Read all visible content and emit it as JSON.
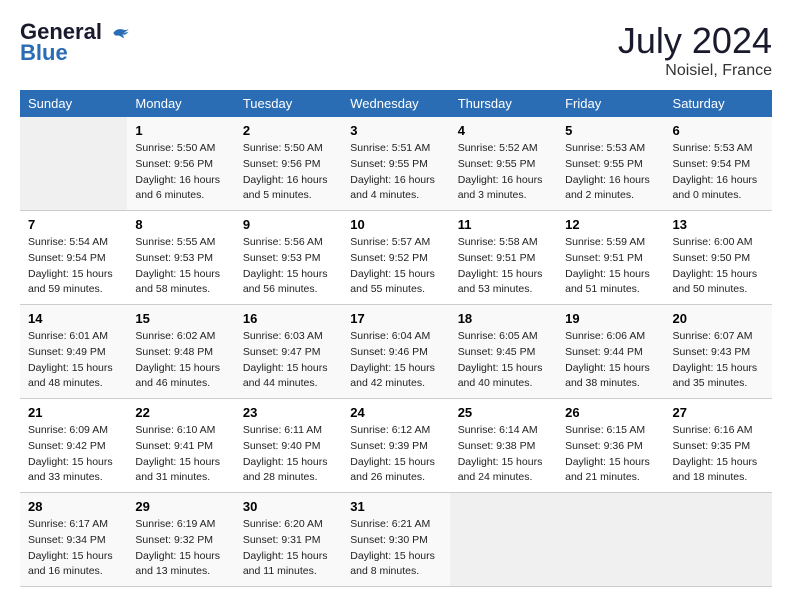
{
  "header": {
    "logo_line1": "General",
    "logo_line2": "Blue",
    "month": "July 2024",
    "location": "Noisiel, France"
  },
  "weekdays": [
    "Sunday",
    "Monday",
    "Tuesday",
    "Wednesday",
    "Thursday",
    "Friday",
    "Saturday"
  ],
  "weeks": [
    [
      {
        "day": "",
        "info": ""
      },
      {
        "day": "1",
        "info": "Sunrise: 5:50 AM\nSunset: 9:56 PM\nDaylight: 16 hours\nand 6 minutes."
      },
      {
        "day": "2",
        "info": "Sunrise: 5:50 AM\nSunset: 9:56 PM\nDaylight: 16 hours\nand 5 minutes."
      },
      {
        "day": "3",
        "info": "Sunrise: 5:51 AM\nSunset: 9:55 PM\nDaylight: 16 hours\nand 4 minutes."
      },
      {
        "day": "4",
        "info": "Sunrise: 5:52 AM\nSunset: 9:55 PM\nDaylight: 16 hours\nand 3 minutes."
      },
      {
        "day": "5",
        "info": "Sunrise: 5:53 AM\nSunset: 9:55 PM\nDaylight: 16 hours\nand 2 minutes."
      },
      {
        "day": "6",
        "info": "Sunrise: 5:53 AM\nSunset: 9:54 PM\nDaylight: 16 hours\nand 0 minutes."
      }
    ],
    [
      {
        "day": "7",
        "info": "Sunrise: 5:54 AM\nSunset: 9:54 PM\nDaylight: 15 hours\nand 59 minutes."
      },
      {
        "day": "8",
        "info": "Sunrise: 5:55 AM\nSunset: 9:53 PM\nDaylight: 15 hours\nand 58 minutes."
      },
      {
        "day": "9",
        "info": "Sunrise: 5:56 AM\nSunset: 9:53 PM\nDaylight: 15 hours\nand 56 minutes."
      },
      {
        "day": "10",
        "info": "Sunrise: 5:57 AM\nSunset: 9:52 PM\nDaylight: 15 hours\nand 55 minutes."
      },
      {
        "day": "11",
        "info": "Sunrise: 5:58 AM\nSunset: 9:51 PM\nDaylight: 15 hours\nand 53 minutes."
      },
      {
        "day": "12",
        "info": "Sunrise: 5:59 AM\nSunset: 9:51 PM\nDaylight: 15 hours\nand 51 minutes."
      },
      {
        "day": "13",
        "info": "Sunrise: 6:00 AM\nSunset: 9:50 PM\nDaylight: 15 hours\nand 50 minutes."
      }
    ],
    [
      {
        "day": "14",
        "info": "Sunrise: 6:01 AM\nSunset: 9:49 PM\nDaylight: 15 hours\nand 48 minutes."
      },
      {
        "day": "15",
        "info": "Sunrise: 6:02 AM\nSunset: 9:48 PM\nDaylight: 15 hours\nand 46 minutes."
      },
      {
        "day": "16",
        "info": "Sunrise: 6:03 AM\nSunset: 9:47 PM\nDaylight: 15 hours\nand 44 minutes."
      },
      {
        "day": "17",
        "info": "Sunrise: 6:04 AM\nSunset: 9:46 PM\nDaylight: 15 hours\nand 42 minutes."
      },
      {
        "day": "18",
        "info": "Sunrise: 6:05 AM\nSunset: 9:45 PM\nDaylight: 15 hours\nand 40 minutes."
      },
      {
        "day": "19",
        "info": "Sunrise: 6:06 AM\nSunset: 9:44 PM\nDaylight: 15 hours\nand 38 minutes."
      },
      {
        "day": "20",
        "info": "Sunrise: 6:07 AM\nSunset: 9:43 PM\nDaylight: 15 hours\nand 35 minutes."
      }
    ],
    [
      {
        "day": "21",
        "info": "Sunrise: 6:09 AM\nSunset: 9:42 PM\nDaylight: 15 hours\nand 33 minutes."
      },
      {
        "day": "22",
        "info": "Sunrise: 6:10 AM\nSunset: 9:41 PM\nDaylight: 15 hours\nand 31 minutes."
      },
      {
        "day": "23",
        "info": "Sunrise: 6:11 AM\nSunset: 9:40 PM\nDaylight: 15 hours\nand 28 minutes."
      },
      {
        "day": "24",
        "info": "Sunrise: 6:12 AM\nSunset: 9:39 PM\nDaylight: 15 hours\nand 26 minutes."
      },
      {
        "day": "25",
        "info": "Sunrise: 6:14 AM\nSunset: 9:38 PM\nDaylight: 15 hours\nand 24 minutes."
      },
      {
        "day": "26",
        "info": "Sunrise: 6:15 AM\nSunset: 9:36 PM\nDaylight: 15 hours\nand 21 minutes."
      },
      {
        "day": "27",
        "info": "Sunrise: 6:16 AM\nSunset: 9:35 PM\nDaylight: 15 hours\nand 18 minutes."
      }
    ],
    [
      {
        "day": "28",
        "info": "Sunrise: 6:17 AM\nSunset: 9:34 PM\nDaylight: 15 hours\nand 16 minutes."
      },
      {
        "day": "29",
        "info": "Sunrise: 6:19 AM\nSunset: 9:32 PM\nDaylight: 15 hours\nand 13 minutes."
      },
      {
        "day": "30",
        "info": "Sunrise: 6:20 AM\nSunset: 9:31 PM\nDaylight: 15 hours\nand 11 minutes."
      },
      {
        "day": "31",
        "info": "Sunrise: 6:21 AM\nSunset: 9:30 PM\nDaylight: 15 hours\nand 8 minutes."
      },
      {
        "day": "",
        "info": ""
      },
      {
        "day": "",
        "info": ""
      },
      {
        "day": "",
        "info": ""
      }
    ]
  ]
}
